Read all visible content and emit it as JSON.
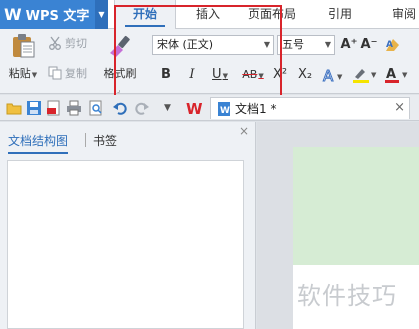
{
  "app": {
    "name": "WPS 文字",
    "logo": "W"
  },
  "menu": {
    "tabs": [
      "开始",
      "插入",
      "页面布局",
      "引用",
      "审阅"
    ],
    "active": "开始"
  },
  "ribbon": {
    "paste_label": "粘贴",
    "cut_label": "剪切",
    "copy_label": "复制",
    "format_painter_label": "格式刷",
    "font_name": "宋体 (正文)",
    "font_size": "五号",
    "bold_label": "B",
    "italic_label": "I",
    "underline_label": "U",
    "strikethrough_label": "AB",
    "superscript_label": "X²",
    "subscript_label": "X₂",
    "grow_font_label": "A⁺",
    "shrink_font_label": "A⁻",
    "highlight_color": "#f5e400",
    "font_color": "#d8242b"
  },
  "document": {
    "tab_title": "文档1 *",
    "close_glyph": "×"
  },
  "left_pane": {
    "tab_outline": "文档结构图",
    "tab_bookmark": "书签",
    "close_glyph": "×"
  },
  "watermark": "软件技巧",
  "colors": {
    "accent": "#2f6fba",
    "app_blue": "#3a83d3",
    "highlight_border": "#d8242b",
    "page_header": "#d6ecd4"
  }
}
